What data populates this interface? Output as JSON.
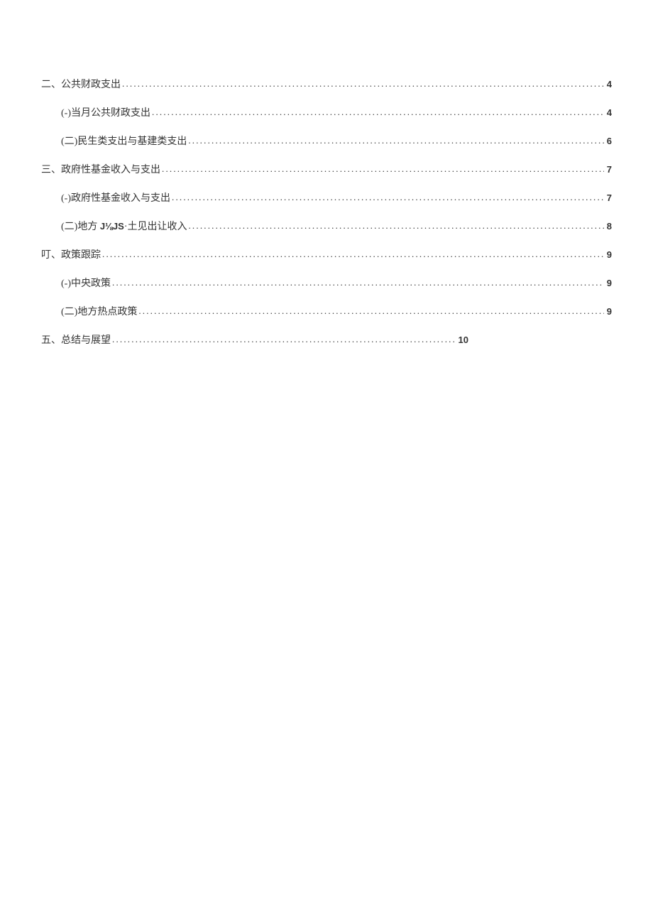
{
  "toc": [
    {
      "level": 1,
      "title": "二、公共财政支出",
      "page": "4",
      "short": false
    },
    {
      "level": 2,
      "title": "(-)当月公共财政支出",
      "page": "4",
      "short": false
    },
    {
      "level": 2,
      "title": "(二)民生类支出与基建类支出",
      "page": "6",
      "short": false
    },
    {
      "level": 1,
      "title": "三、政府性基金收入与支出",
      "page": "7",
      "short": false
    },
    {
      "level": 2,
      "title": "(-)政府性基金收入与支出",
      "page": "7",
      "short": false
    },
    {
      "level": 2,
      "title_prefix": "(二)地方 ",
      "title_bold": "J⅛JS",
      "title_suffix": "·土见出让收入",
      "page": "8",
      "short": false
    },
    {
      "level": 1,
      "title": "叮、政策跟踪",
      "page": "9",
      "short": false
    },
    {
      "level": 2,
      "title": "(-)中央政策",
      "page": "9",
      "short": false
    },
    {
      "level": 2,
      "title": "(二)地方热点政策",
      "page": "9",
      "short": false
    },
    {
      "level": 1,
      "title": "五、总结与展望",
      "page": "10",
      "short": true
    }
  ]
}
